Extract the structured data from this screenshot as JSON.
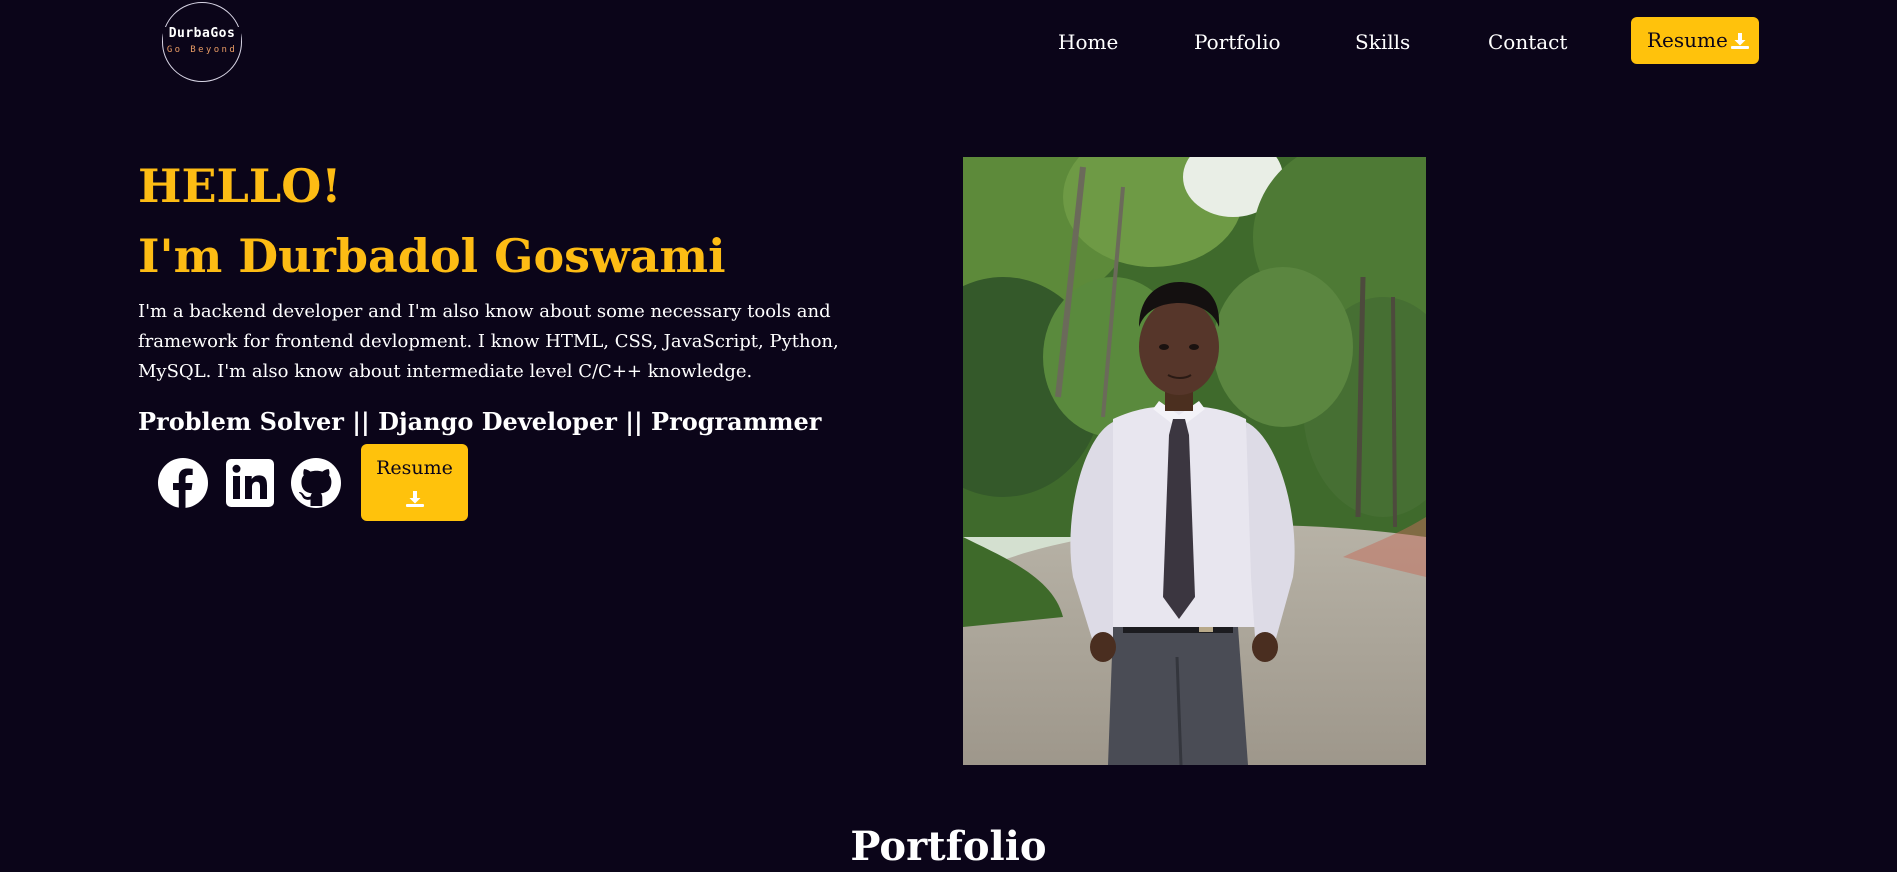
{
  "logo": {
    "name": "DurbaGos",
    "tagline": "Go Beyond"
  },
  "nav": {
    "home": "Home",
    "portfolio": "Portfolio",
    "skills": "Skills",
    "contact": "Contact",
    "resume": "Resume",
    "resume_icon": "download-icon"
  },
  "hero": {
    "greeting": "HELLO!",
    "name": "I'm Durbadol Goswami",
    "bio": "I'm a backend developer and I'm also know about some necessary tools and framework for frontend devlopment. I know HTML, CSS, JavaScript, Python, MySQL. I'm also know about intermediate level C/C++ knowledge.",
    "tagline": "Problem Solver || Django Developer || Programmer",
    "social_icons": [
      "facebook-icon",
      "linkedin-icon",
      "github-icon"
    ],
    "resume_button": "Resume",
    "resume_button_icon": "download-icon"
  },
  "photo": {
    "alt": "Profile photo"
  },
  "sections": {
    "portfolio_title": "Portfolio"
  },
  "colors": {
    "background": "#0b0519",
    "accent": "#fdbc14",
    "button": "#ffc20c",
    "text": "#ffffff",
    "logo_tagline": "#e79a64"
  }
}
